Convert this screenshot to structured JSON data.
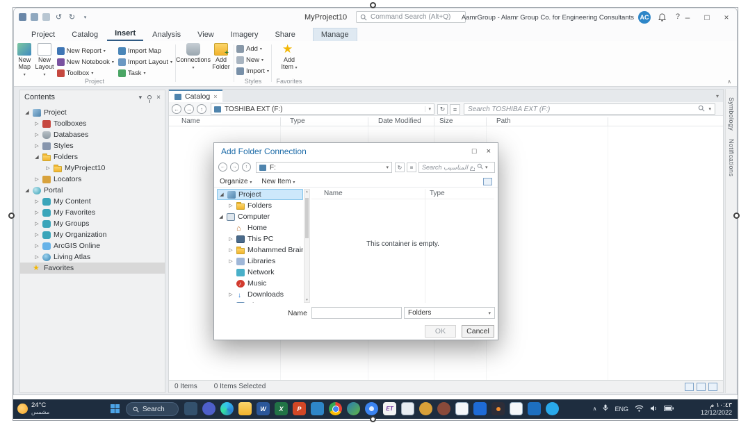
{
  "colors": {
    "taskbar_bg": "#1e2d3f",
    "selection_blue": "#cde8fb",
    "dialog_title": "#1e6ca8",
    "favorite_star": "#f2b705"
  },
  "titlebar": {
    "project_title": "MyProject10",
    "command_search_placeholder": "Command Search (Alt+Q)",
    "account_name": "AamrGroup - Alamr Group Co. for Engineering Consultants",
    "avatar_initials": "AC",
    "help": "?",
    "window_controls": {
      "minimize": "–",
      "maximize": "□",
      "close": "×"
    }
  },
  "ribbon": {
    "tabs": [
      "Project",
      "Catalog",
      "Insert",
      "Analysis",
      "View",
      "Imagery",
      "Share",
      "Manage"
    ],
    "active_tab": "Insert",
    "new_map": {
      "line1": "New",
      "line2": "Map"
    },
    "new_layout": {
      "line1": "New",
      "line2": "Layout"
    },
    "new_report": "New Report",
    "new_notebook": "New Notebook",
    "toolbox": "Toolbox",
    "import_map": "Import Map",
    "import_layout": "Import Layout",
    "task": "Task",
    "group_project": "Project",
    "connections": "Connections",
    "add_folder": {
      "line1": "Add",
      "line2": "Folder"
    },
    "styles_add": "Add",
    "styles_new": "New",
    "styles_import": "Import",
    "group_styles": "Styles",
    "add_item": {
      "line1": "Add",
      "line2": "Item"
    },
    "group_favorites": "Favorites"
  },
  "contents_panel": {
    "title": "Contents",
    "items": [
      {
        "label": "Project",
        "level": 0,
        "expanded": true
      },
      {
        "label": "Toolboxes",
        "level": 1
      },
      {
        "label": "Databases",
        "level": 1
      },
      {
        "label": "Styles",
        "level": 1
      },
      {
        "label": "Folders",
        "level": 1,
        "expanded": true
      },
      {
        "label": "MyProject10",
        "level": 2
      },
      {
        "label": "Locators",
        "level": 1
      },
      {
        "label": "Portal",
        "level": 0,
        "expanded": true
      },
      {
        "label": "My Content",
        "level": 1
      },
      {
        "label": "My Favorites",
        "level": 1
      },
      {
        "label": "My Groups",
        "level": 1
      },
      {
        "label": "My Organization",
        "level": 1
      },
      {
        "label": "ArcGIS Online",
        "level": 1
      },
      {
        "label": "Living Atlas",
        "level": 1
      },
      {
        "label": "Favorites",
        "level": 0,
        "selected": true
      }
    ]
  },
  "catalog": {
    "tab_label": "Catalog",
    "address": "TOSHIBA EXT (F:)",
    "search_placeholder": "Search TOSHIBA EXT (F:)",
    "columns": [
      "Name",
      "Type",
      "Date Modified",
      "Size",
      "Path"
    ],
    "status_items": "0 Items",
    "status_selected": "0 Items Selected"
  },
  "side_tabs": [
    "Symbology",
    "Notifications"
  ],
  "dialog": {
    "title": "Add Folder Connection",
    "address": "F:",
    "search_placeholder": "Search مشروع المناسيب",
    "toolbar": {
      "organize": "Organize",
      "new_item": "New Item"
    },
    "tree": [
      {
        "label": "Project",
        "level": 0,
        "expanded": true,
        "selected": true
      },
      {
        "label": "Folders",
        "level": 1
      },
      {
        "label": "Computer",
        "level": 0,
        "expanded": true
      },
      {
        "label": "Home",
        "level": 1
      },
      {
        "label": "This PC",
        "level": 1
      },
      {
        "label": "Mohammed Braima",
        "level": 1
      },
      {
        "label": "Libraries",
        "level": 1
      },
      {
        "label": "Network",
        "level": 1
      },
      {
        "label": "Music",
        "level": 1
      },
      {
        "label": "Downloads",
        "level": 1
      },
      {
        "label": "Pictures",
        "level": 1
      }
    ],
    "columns": [
      "Name",
      "Type"
    ],
    "empty_message": "This container is empty.",
    "name_label": "Name",
    "name_value": "",
    "filter_value": "Folders",
    "ok_label": "OK",
    "cancel_label": "Cancel"
  },
  "taskbar": {
    "weather_temp": "24°C",
    "weather_desc": "مشمس",
    "search_label": "Search",
    "tray_lang": "ENG",
    "time": "١٠:٤٣ م",
    "date": "12/12/2022",
    "apps": [
      {
        "name": "This PC"
      },
      {
        "name": "Chat"
      },
      {
        "name": "Microsoft Edge"
      },
      {
        "name": "File Explorer"
      },
      {
        "name": "Word",
        "glyph": "W"
      },
      {
        "name": "Excel",
        "glyph": "X"
      },
      {
        "name": "PowerPoint",
        "glyph": "P"
      },
      {
        "name": "Store"
      },
      {
        "name": "Chrome"
      },
      {
        "name": "ArcGIS Pro"
      },
      {
        "name": "Google Earth"
      },
      {
        "name": "ET",
        "glyph": "ET"
      },
      {
        "name": "Notepad"
      },
      {
        "name": "Contact"
      },
      {
        "name": "Profile"
      },
      {
        "name": "Document"
      },
      {
        "name": "Photos"
      },
      {
        "name": "Media Player"
      },
      {
        "name": "Document"
      },
      {
        "name": "Paint"
      },
      {
        "name": "Telegram"
      }
    ]
  }
}
